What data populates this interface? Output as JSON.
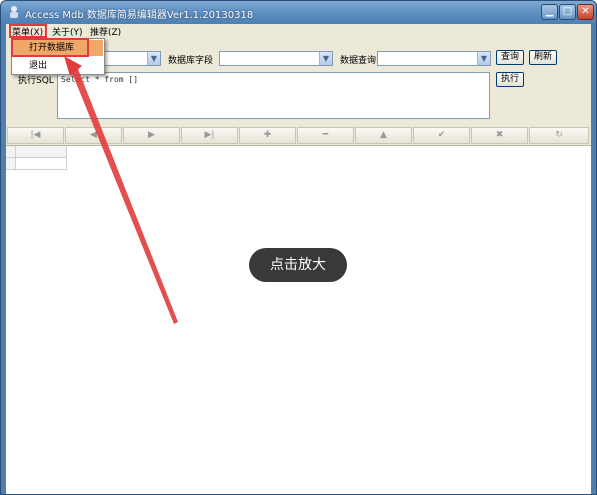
{
  "window": {
    "title": "Access Mdb 数据库简易编辑器Ver1.1.20130318",
    "minimize": "▁",
    "maximize": "□",
    "close": "✕"
  },
  "menubar": {
    "items": [
      "菜单(X)",
      "关于(Y)",
      "推荐(Z)"
    ]
  },
  "dropdown": {
    "items": [
      "打开数据库",
      "退出"
    ]
  },
  "panel": {
    "field_label": "数据库字段",
    "query_label": "数据查询",
    "query_button": "查询",
    "refresh_button": "刷新",
    "exec_label": "执行SQL",
    "exec_button": "执行",
    "sql_text": "Select * from []"
  },
  "navbar": {
    "buttons": [
      {
        "icon": "first-record-icon",
        "glyph": "|◀"
      },
      {
        "icon": "prev-record-icon",
        "glyph": "◀"
      },
      {
        "icon": "next-record-icon",
        "glyph": "▶"
      },
      {
        "icon": "last-record-icon",
        "glyph": "▶|"
      },
      {
        "icon": "add-record-icon",
        "glyph": "✚"
      },
      {
        "icon": "delete-record-icon",
        "glyph": "━"
      },
      {
        "icon": "edit-record-icon",
        "glyph": "▲"
      },
      {
        "icon": "post-edit-icon",
        "glyph": "✔"
      },
      {
        "icon": "cancel-edit-icon",
        "glyph": "✖"
      },
      {
        "icon": "refresh-data-icon",
        "glyph": "↻"
      }
    ]
  },
  "overlay": {
    "zoom_text": "点击放大"
  },
  "colors": {
    "annotation_red": "#e23b3b",
    "highlight_orange": "#f0a868",
    "title_blue": "#5b8dbf"
  }
}
